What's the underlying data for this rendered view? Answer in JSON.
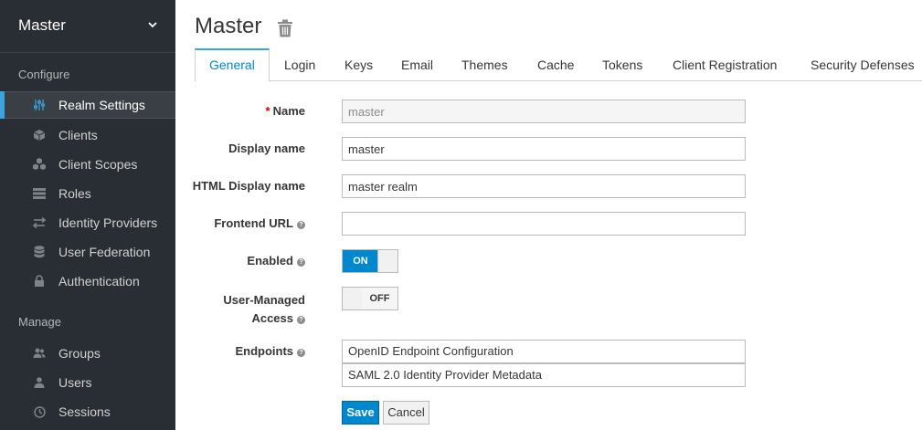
{
  "sidebar": {
    "realm_selector": "Master",
    "sections": [
      {
        "heading": "Configure"
      },
      {
        "heading": "Manage"
      }
    ],
    "items": [
      {
        "label": "Realm Settings",
        "icon": "sliders-icon",
        "active": true
      },
      {
        "label": "Clients",
        "icon": "cube-icon"
      },
      {
        "label": "Client Scopes",
        "icon": "cubes-icon"
      },
      {
        "label": "Roles",
        "icon": "list-icon"
      },
      {
        "label": "Identity Providers",
        "icon": "exchange-icon"
      },
      {
        "label": "User Federation",
        "icon": "database-icon"
      },
      {
        "label": "Authentication",
        "icon": "lock-icon"
      },
      {
        "label": "Groups",
        "icon": "users-icon"
      },
      {
        "label": "Users",
        "icon": "user-icon"
      },
      {
        "label": "Sessions",
        "icon": "clock-icon"
      }
    ]
  },
  "header": {
    "title": "Master",
    "delete_icon": "trash-icon"
  },
  "tabs": [
    {
      "label": "General",
      "active": true
    },
    {
      "label": "Login"
    },
    {
      "label": "Keys"
    },
    {
      "label": "Email"
    },
    {
      "label": "Themes"
    },
    {
      "label": "Cache"
    },
    {
      "label": "Tokens"
    },
    {
      "label": "Client Registration"
    },
    {
      "label": "Security Defenses"
    }
  ],
  "form": {
    "name": {
      "label": "Name",
      "required_mark": "*",
      "value": "master"
    },
    "display_name": {
      "label": "Display name",
      "value": "master"
    },
    "html_display_name": {
      "label": "HTML Display name",
      "value": "master realm"
    },
    "frontend_url": {
      "label": "Frontend URL",
      "value": ""
    },
    "enabled": {
      "label": "Enabled",
      "state": "ON"
    },
    "user_managed_access": {
      "label_line1": "User-Managed",
      "label_line2": "Access",
      "state": "OFF"
    },
    "endpoints": {
      "label": "Endpoints",
      "links": [
        "OpenID Endpoint Configuration",
        "SAML 2.0 Identity Provider Metadata"
      ]
    },
    "help_icon": "question-circle-icon",
    "save_label": "Save",
    "cancel_label": "Cancel"
  },
  "colors": {
    "sidebar_bg": "#292e34",
    "accent": "#0088ce",
    "active_bar": "#39a5dc"
  }
}
